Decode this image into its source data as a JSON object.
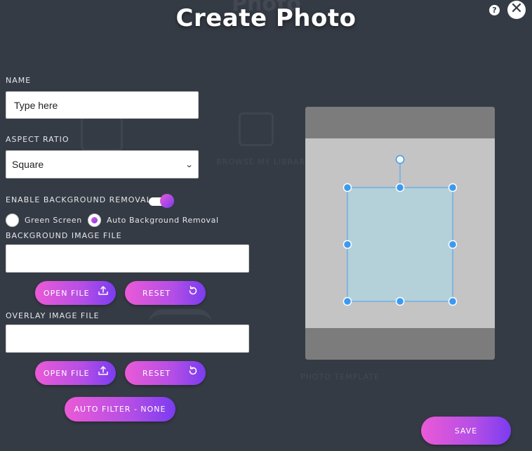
{
  "header": {
    "title": "Create Photo",
    "help_label": "?",
    "close_label": "✕"
  },
  "background_watermarks": {
    "title": "Photo",
    "browse_library": "BROWSE MY LIBRARY",
    "photo_template": "PHOTO TEMPLATE"
  },
  "form": {
    "name": {
      "label": "NAME",
      "value": "",
      "placeholder": "Type here"
    },
    "aspect_ratio": {
      "label": "ASPECT RATIO",
      "selected": "Square"
    },
    "background_removal": {
      "label": "ENABLE BACKGROUND REMOVAL",
      "enabled": true,
      "options": [
        {
          "label": "Green Screen",
          "selected": false
        },
        {
          "label": "Auto Background Removal",
          "selected": true
        }
      ]
    },
    "background_image": {
      "label": "BACKGROUND IMAGE FILE",
      "value": "",
      "open_label": "OPEN FILE",
      "reset_label": "RESET"
    },
    "overlay_image": {
      "label": "OVERLAY IMAGE FILE",
      "value": "",
      "open_label": "OPEN FILE",
      "reset_label": "RESET"
    },
    "auto_filter_label": "AUTO FILTER - NONE"
  },
  "footer": {
    "save_label": "SAVE"
  },
  "colors": {
    "background": "#353b45",
    "accent_start": "#ea5ad6",
    "accent_end": "#7a3cf0",
    "handle": "#3a9af0",
    "crop_fill": "#b4d0d8"
  },
  "icons": {
    "upload": "upload-icon",
    "reset": "reset-icon",
    "help": "help-icon",
    "close": "close-icon"
  }
}
